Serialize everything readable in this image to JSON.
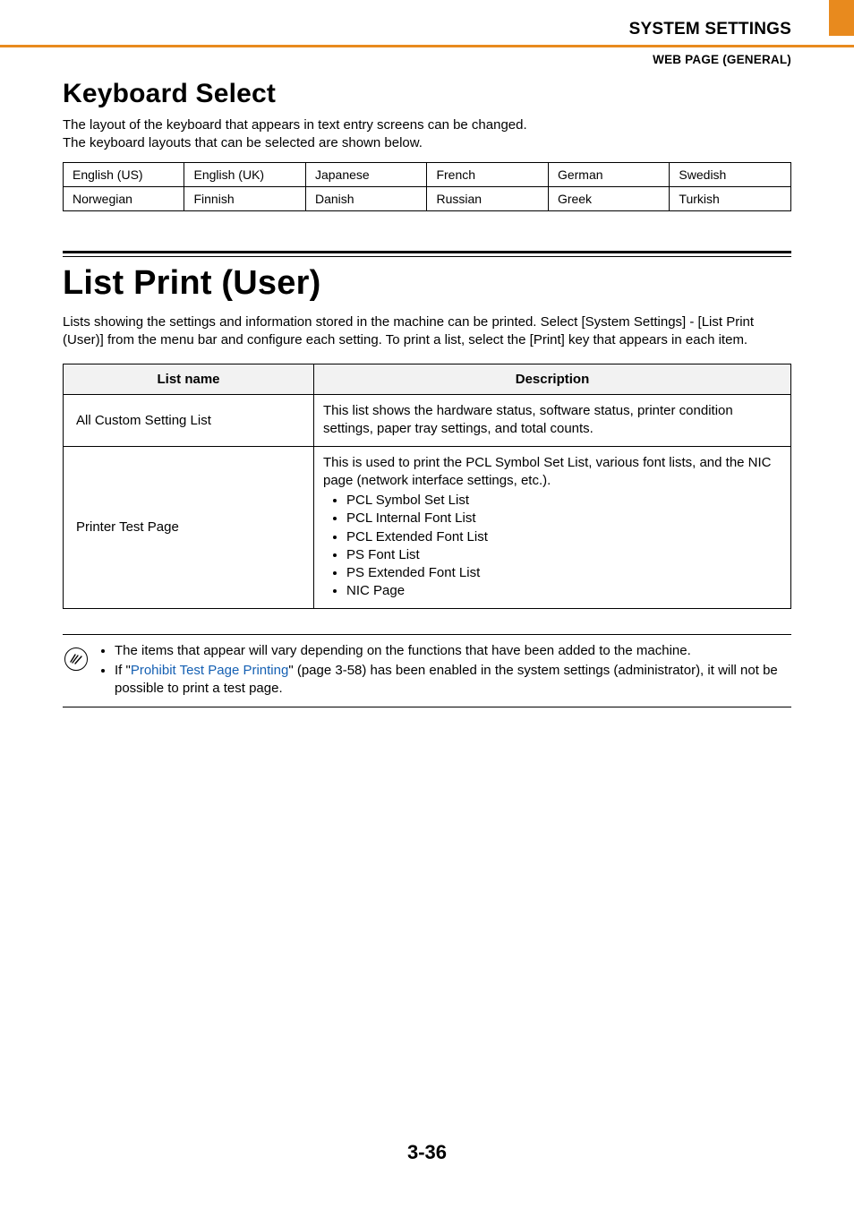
{
  "header": {
    "chapter": "SYSTEM SETTINGS",
    "breadcrumb": "WEB PAGE (GENERAL)"
  },
  "section1": {
    "title": "Keyboard Select",
    "p1": "The layout of the keyboard that appears in text entry screens can be changed.",
    "p2": "The keyboard layouts that can be selected are shown below.",
    "layouts": [
      [
        "English (US)",
        "English (UK)",
        "Japanese",
        "French",
        "German",
        "Swedish"
      ],
      [
        "Norwegian",
        "Finnish",
        "Danish",
        "Russian",
        "Greek",
        "Turkish"
      ]
    ]
  },
  "section2": {
    "title": "List Print (User)",
    "p1": "Lists showing the settings and information stored in the machine can be printed. Select [System Settings] - [List Print (User)] from the menu bar and configure each setting. To print a list, select the [Print] key that appears in each item.",
    "table": {
      "h1": "List name",
      "h2": "Description",
      "rows": [
        {
          "name": "All Custom Setting List",
          "desc": "This list shows the hardware status, software status, printer condition settings, paper tray settings, and total counts."
        },
        {
          "name": "Printer Test Page",
          "desc_intro": "This is used to print the PCL Symbol Set List, various font lists, and the NIC page (network interface settings, etc.).",
          "items": [
            "PCL Symbol Set List",
            "PCL Internal Font List",
            "PCL Extended Font List",
            "PS Font List",
            "PS Extended Font List",
            "NIC Page"
          ]
        }
      ]
    }
  },
  "note": {
    "b1": "The items that appear will vary depending on the functions that have been added to the machine.",
    "b2_prefix": "If \"",
    "b2_link": "Prohibit Test Page Printing",
    "b2_suffix": "\" (page 3-58) has been enabled in the system settings (administrator), it will not be possible to print a test page."
  },
  "page_number": "3-36"
}
